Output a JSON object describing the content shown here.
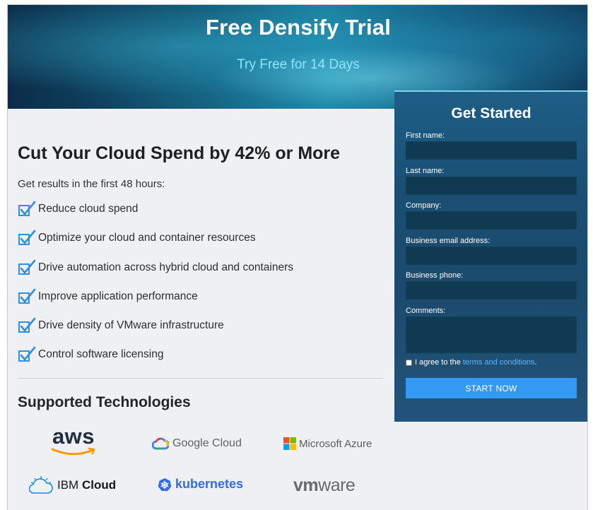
{
  "hero": {
    "title": "Free Densify Trial",
    "subtitle": "Try Free for 14 Days"
  },
  "main": {
    "headline": "Cut Your Cloud Spend by 42% or More",
    "intro": "Get results in the first 48 hours:",
    "benefits": [
      "Reduce cloud spend",
      "Optimize your cloud and container resources",
      "Drive automation across hybrid cloud and containers",
      "Improve application performance",
      "Drive density of VMware infrastructure",
      "Control software licensing"
    ],
    "supported_title": "Supported Technologies",
    "logos": {
      "aws": "aws",
      "google_cloud": "Google Cloud",
      "azure": "Microsoft Azure",
      "ibm_prefix": "IBM",
      "ibm_bold": "Cloud",
      "kubernetes": "kubernetes",
      "vmware_vm": "vm",
      "vmware_ware": "ware"
    }
  },
  "form": {
    "title": "Get Started",
    "fields": {
      "first_name": {
        "label": "First name:",
        "value": ""
      },
      "last_name": {
        "label": "Last name:",
        "value": ""
      },
      "company": {
        "label": "Company:",
        "value": ""
      },
      "email": {
        "label": "Business email address:",
        "value": ""
      },
      "phone": {
        "label": "Business phone:",
        "value": ""
      },
      "comments": {
        "label": "Comments:",
        "value": ""
      }
    },
    "agree_text": "I agree to the",
    "agree_link": "terms and conditions",
    "agree_suffix": ".",
    "submit_label": "START NOW"
  },
  "colors": {
    "accent": "#3399f3",
    "check": "#2f8fe0",
    "link": "#5eb7ff",
    "hero_subtitle": "#8fe6ff"
  }
}
